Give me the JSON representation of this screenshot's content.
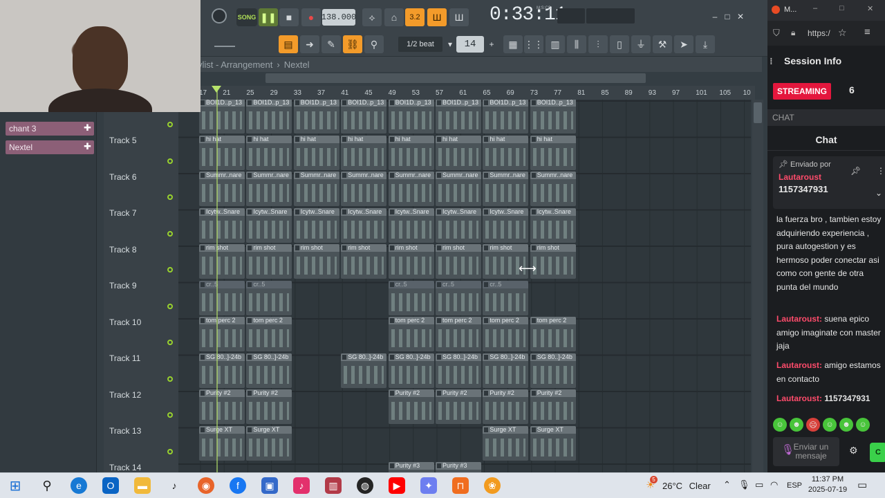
{
  "fl": {
    "tempo": "138.000",
    "song_mode": "SONG",
    "time_display": "0:33:11",
    "time_label": "M:S:CS",
    "snap": "1/2 beat",
    "step_value": "14",
    "pattern_digits": "3.2",
    "playlist_title": "ylist - Arrangement",
    "playlist_sep": "›",
    "playlist_pattern": "Nextel",
    "minimize": "–",
    "maximize": "□",
    "close": "✕",
    "bars": [
      "17",
      "21",
      "25",
      "29",
      "33",
      "37",
      "41",
      "45",
      "49",
      "53",
      "57",
      "61",
      "65",
      "69",
      "73",
      "77",
      "81",
      "85",
      "89",
      "93",
      "97",
      "101",
      "105",
      "10"
    ],
    "channels": [
      {
        "label": "chant 3"
      },
      {
        "label": "Nextel"
      }
    ],
    "tracks": [
      "Track 5",
      "Track 6",
      "Track 7",
      "Track 8",
      "Track 9",
      "Track 10",
      "Track 11",
      "Track 12",
      "Track 13",
      "Track 14"
    ],
    "clip_rows": [
      {
        "label": "BOI1D..p_13",
        "positions": [
          0,
          1,
          2,
          3,
          4,
          5,
          6,
          7
        ]
      },
      {
        "label": "hi hat",
        "positions": [
          0,
          1,
          2,
          3,
          4,
          5,
          6,
          7
        ]
      },
      {
        "label": "Summr..nare",
        "positions": [
          0,
          1,
          2,
          3,
          4,
          5,
          6,
          7
        ]
      },
      {
        "label": "Icytw..Snare",
        "positions": [
          0,
          1,
          2,
          3,
          4,
          5,
          6,
          7
        ]
      },
      {
        "label": "rim shot",
        "positions": [
          0,
          1,
          2,
          3,
          4,
          5,
          6,
          7
        ]
      },
      {
        "label": "cr..5",
        "positions": [
          0,
          1,
          4,
          5,
          6
        ]
      },
      {
        "label": "tom perc 2",
        "positions": [
          0,
          1,
          4,
          5,
          6,
          7
        ]
      },
      {
        "label": "SG 80..]-24b",
        "positions": [
          0,
          1,
          3,
          4,
          5,
          6,
          7
        ]
      },
      {
        "label": "Purity #2",
        "positions": [
          0,
          1,
          4,
          5,
          6,
          7
        ]
      },
      {
        "label": "Surge XT",
        "positions": [
          0,
          1,
          6,
          7
        ]
      },
      {
        "label": "Purity #3",
        "positions": [
          4,
          5
        ]
      }
    ]
  },
  "side": {
    "tab_label": "M...",
    "url": "https:/",
    "session_title": "Session Info",
    "stream_badge": "STREAMING",
    "viewers": "6",
    "chat_section": "CHAT",
    "chat_title": "Chat",
    "pinned_by": "Enviado por",
    "pinned_user": "Lautaroust",
    "pinned_text": "1157347931",
    "messages": [
      {
        "user": "",
        "text": "la fuerza bro , tambien estoy adquiriendo experiencia , pura autogestion y es hermoso poder conectar asi como con gente de otra punta del mundo"
      },
      {
        "user": "Lautaroust:",
        "text": "suena epico amigo imaginate con master jaja"
      },
      {
        "user": "Lautaroust:",
        "text": "amigo estamos en contacto"
      },
      {
        "user": "Lautaroust:",
        "text": "1157347931"
      }
    ],
    "input_placeholder": "Enviar un mensaje",
    "send_label": "C"
  },
  "taskbar": {
    "weather_temp": "26°C",
    "weather_desc": "Clear",
    "lang": "ESP",
    "time": "11:37 PM",
    "date": "2025-07-19",
    "weather_badge": "5"
  },
  "colors": {
    "accent_orange": "#f39b2a",
    "stream_red": "#e4173d",
    "chat_user": "#ff4b6b",
    "playhead": "#b7e36b"
  }
}
